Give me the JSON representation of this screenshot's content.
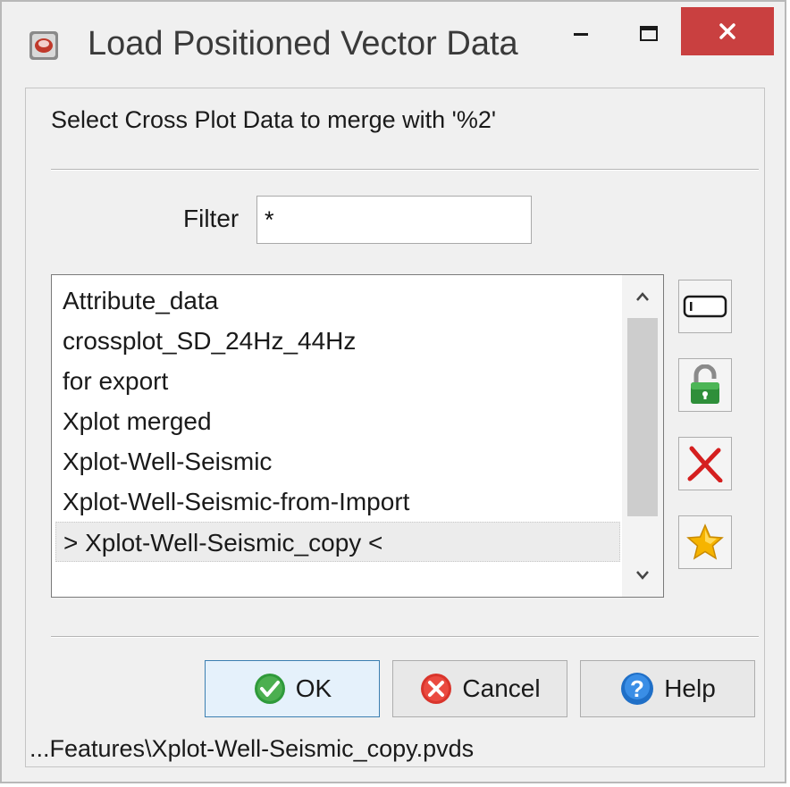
{
  "window": {
    "title": "Load Positioned Vector Data",
    "icon": "app-icon",
    "controls": [
      "minimize",
      "maximize",
      "close"
    ]
  },
  "dialog": {
    "prompt": "Select Cross Plot Data to merge with '%2'",
    "filter": {
      "label": "Filter",
      "value": "*"
    },
    "list": {
      "items": [
        "Attribute_data",
        "crossplot_SD_24Hz_44Hz",
        "for export",
        "Xplot merged",
        "Xplot-Well-Seismic",
        "Xplot-Well-Seismic-from-Import",
        "> Xplot-Well-Seismic_copy <"
      ],
      "selected_index": 6
    },
    "side_buttons": [
      "rename-icon",
      "unlock-icon",
      "delete-icon",
      "star-icon"
    ],
    "buttons": {
      "ok": "OK",
      "cancel": "Cancel",
      "help": "Help"
    },
    "status": "...Features\\Xplot-Well-Seismic_copy.pvds"
  },
  "colors": {
    "close_button": "#c94040",
    "ok_icon": "#2f9a3a",
    "cancel_icon": "#d9342b",
    "help_icon": "#1f6fc7",
    "star": "#f6b400"
  }
}
